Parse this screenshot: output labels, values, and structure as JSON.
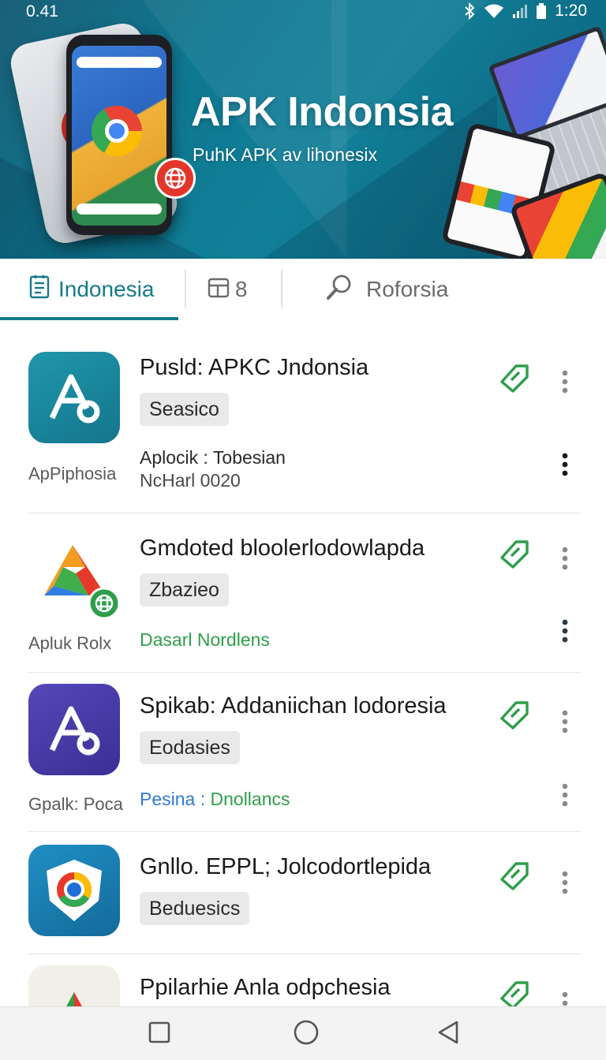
{
  "status_bar": {
    "time_left": "0.41",
    "time_right": "1:20"
  },
  "banner": {
    "title": "APK Indonsia",
    "subtitle": "PuhK APK av lihonesix"
  },
  "tabs": [
    {
      "label": "Indonesia",
      "icon": "document-icon",
      "active": true
    },
    {
      "label": "8",
      "icon": "layout-icon",
      "active": false
    },
    {
      "label": "Roforsia",
      "icon": "search-icon",
      "active": false
    }
  ],
  "apps": [
    {
      "title": "Pusld: APKC Jndonsia",
      "chip": "Seasico",
      "side_label": "ApPiphosia",
      "meta_line1": "Aplocik : Tobesian",
      "meta_line2": "NcHarl 0020",
      "icon": "apk-a-icon",
      "color": "#1e8aa0"
    },
    {
      "title": "Gmdoted bloolerlodowlapda",
      "chip": "Zbazieo",
      "side_label": "Apluk Rolx",
      "meta_line1": "Dasarl Nordlens",
      "icon": "triangle-globe-icon",
      "color": "#2e9e4a"
    },
    {
      "title": "Spikab: Addaniichan lodoresia",
      "chip": "Eodasies",
      "side_label": "Gpalk: Poca",
      "meta_part1": "Pesina :",
      "meta_part2": "Dnollancs",
      "icon": "apk-a-icon",
      "color": "#4a3ea8"
    },
    {
      "title": "Gnllo. EPPL; Jolcodortlepida",
      "chip": "Beduesics",
      "icon": "chrome-shield-icon",
      "color": "#1b7fb0"
    },
    {
      "title": "Ppilarhie Anla odpchesia",
      "icon": "triangle-icon",
      "color": "#f2efe8"
    }
  ],
  "colors": {
    "accent": "#147a8a",
    "download_green": "#2e9e4a",
    "link_blue": "#2d7ad6"
  }
}
